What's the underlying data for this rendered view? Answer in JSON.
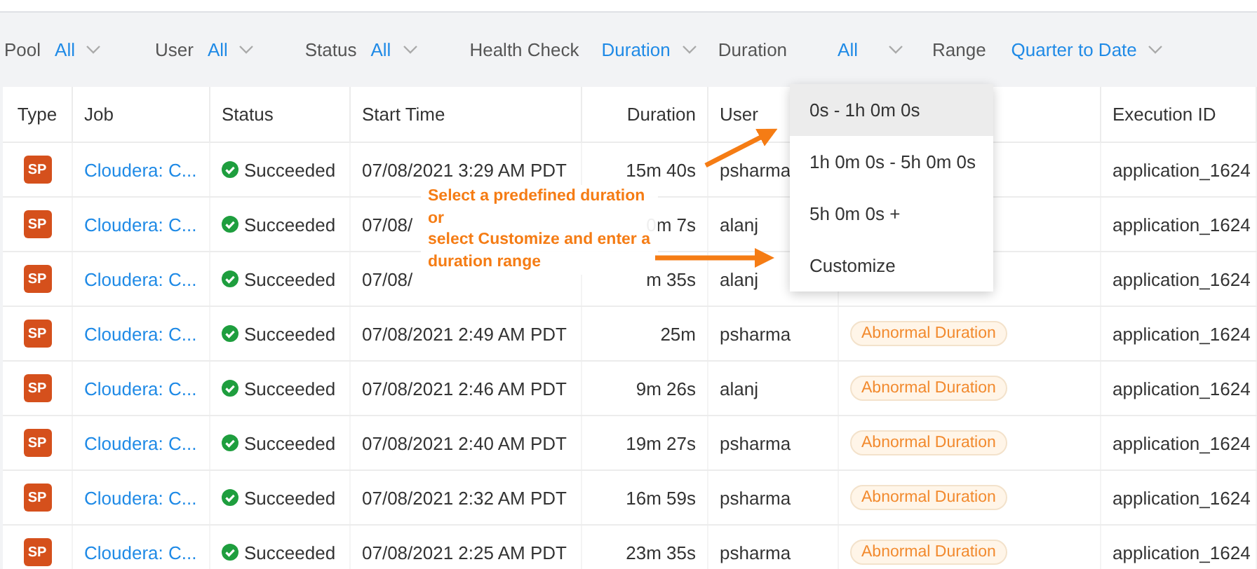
{
  "filters": [
    {
      "label": "Pool",
      "value": "All"
    },
    {
      "label": "User",
      "value": "All"
    },
    {
      "label": "Status",
      "value": "All"
    },
    {
      "label": "Health Check",
      "value": "Duration"
    },
    {
      "label": "Duration",
      "value": "All"
    },
    {
      "label": "Range",
      "value": "Quarter to Date"
    }
  ],
  "table": {
    "columns": [
      "Type",
      "Job",
      "Status",
      "Start Time",
      "Duration",
      "User",
      "Execution ID"
    ],
    "rows": [
      {
        "type": "SP",
        "job": "Cloudera: C...",
        "status": "Succeeded",
        "start_time": "07/08/2021 3:29 AM PDT",
        "duration": "15m 40s",
        "user": "psharma",
        "execution_id": "application_1624"
      },
      {
        "type": "SP",
        "job": "Cloudera: C...",
        "status": "Succeeded",
        "start_time": "07/08/",
        "duration": "0m 7s",
        "user": "alanj",
        "execution_id": "application_1624"
      },
      {
        "type": "SP",
        "job": "Cloudera: C...",
        "status": "Succeeded",
        "start_time": "07/08/",
        "duration": "m 35s",
        "user": "alanj",
        "execution_id": "application_1624"
      },
      {
        "type": "SP",
        "job": "Cloudera: C...",
        "status": "Succeeded",
        "start_time": "07/08/2021 2:49 AM PDT",
        "duration": "25m",
        "user": "psharma",
        "health": "Abnormal Duration",
        "execution_id": "application_1624"
      },
      {
        "type": "SP",
        "job": "Cloudera: C...",
        "status": "Succeeded",
        "start_time": "07/08/2021 2:46 AM PDT",
        "duration": "9m 26s",
        "user": "alanj",
        "health": "Abnormal Duration",
        "execution_id": "application_1624"
      },
      {
        "type": "SP",
        "job": "Cloudera: C...",
        "status": "Succeeded",
        "start_time": "07/08/2021 2:40 AM PDT",
        "duration": "19m 27s",
        "user": "psharma",
        "health": "Abnormal Duration",
        "execution_id": "application_1624"
      },
      {
        "type": "SP",
        "job": "Cloudera: C...",
        "status": "Succeeded",
        "start_time": "07/08/2021 2:32 AM PDT",
        "duration": "16m 59s",
        "user": "psharma",
        "health": "Abnormal Duration",
        "execution_id": "application_1624"
      },
      {
        "type": "SP",
        "job": "Cloudera: C...",
        "status": "Succeeded",
        "start_time": "07/08/2021 2:25 AM PDT",
        "duration": "23m 35s",
        "user": "psharma",
        "health": "Abnormal Duration",
        "execution_id": "application_1624"
      }
    ]
  },
  "duration_menu": {
    "options": [
      {
        "label": "0s - 1h 0m 0s",
        "selected": true
      },
      {
        "label": "1h 0m 0s - 5h 0m 0s",
        "selected": false
      },
      {
        "label": "5h 0m 0s +",
        "selected": false
      },
      {
        "label": "Customize",
        "selected": false
      }
    ]
  },
  "annotation": {
    "text": "Select a predefined duration\nor\nselect Customize and enter a\nduration range"
  }
}
